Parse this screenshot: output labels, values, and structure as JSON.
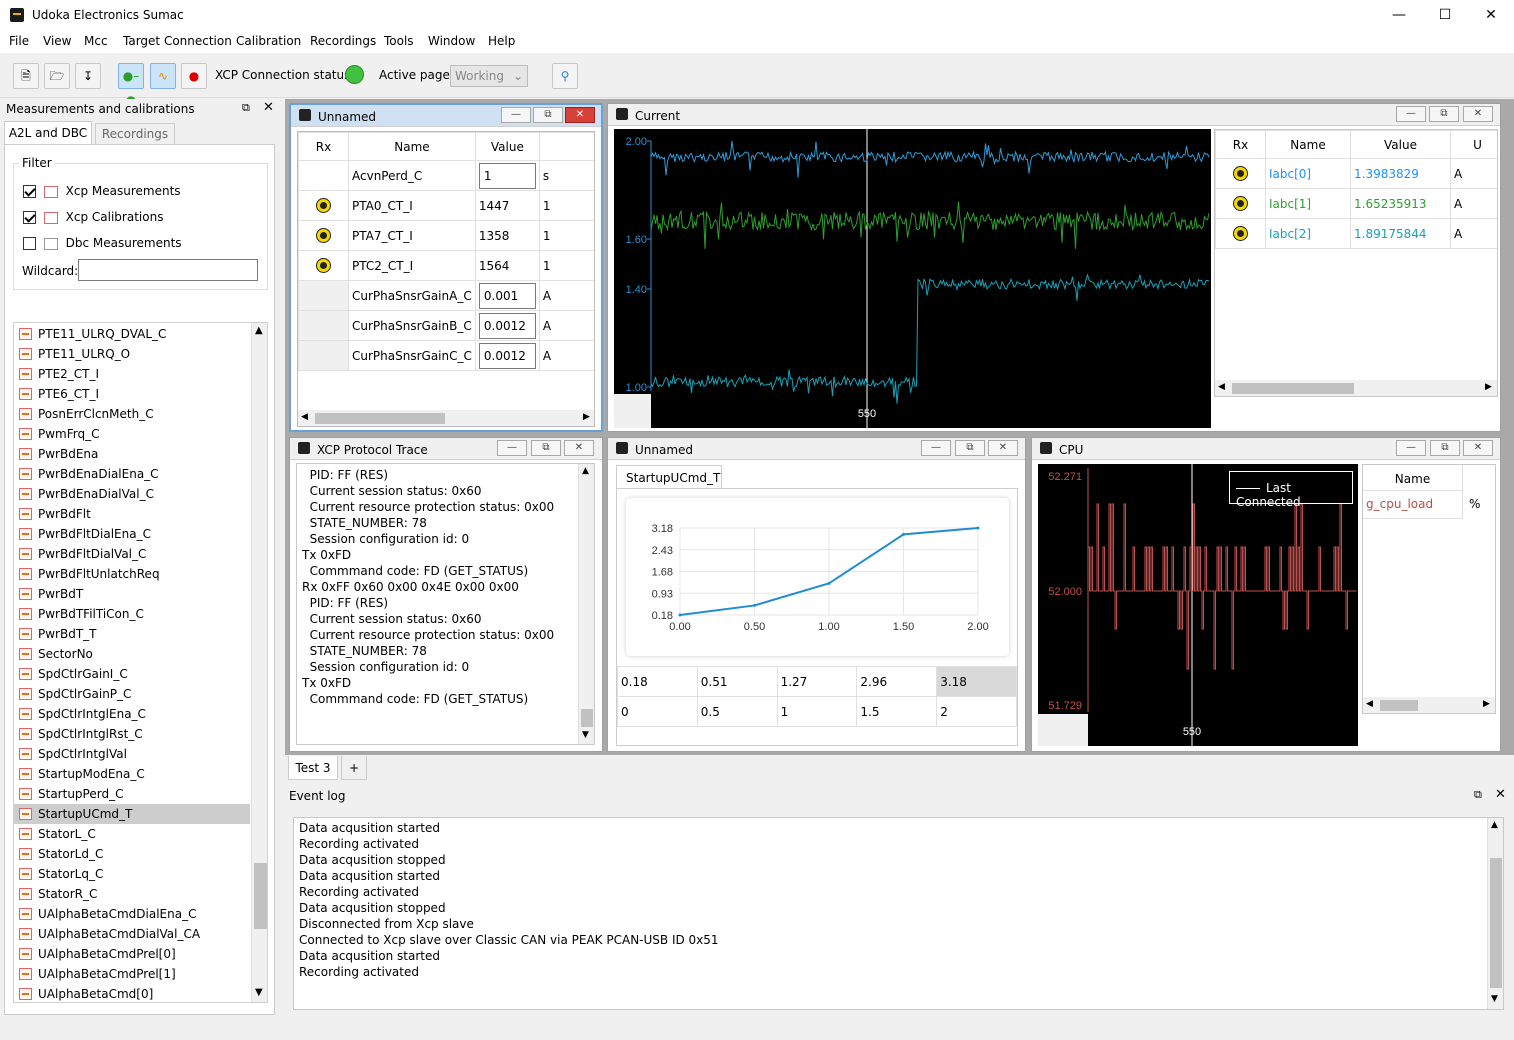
{
  "app": {
    "title": "Udoka Electronics Sumac"
  },
  "menu": [
    "File",
    "View",
    "Mcc",
    "Target Connection",
    "Calibration",
    "Recordings",
    "Tools",
    "Window",
    "Help"
  ],
  "toolbar": {
    "xcp_status_label": "XCP Connection status:",
    "active_page_label": "Active page:",
    "active_page_value": "Working"
  },
  "left_panel": {
    "title": "Measurements and calibrations",
    "tabs": [
      "A2L and DBC",
      "Recordings"
    ],
    "filter_label": "Filter",
    "filters": [
      "Xcp Measurements",
      "Xcp Calibrations",
      "Dbc Measurements"
    ],
    "wildcard_label": "Wildcard:",
    "items": [
      "PTE11_ULRQ_DVAL_C",
      "PTE11_ULRQ_O",
      "PTE2_CT_I",
      "PTE6_CT_I",
      "PosnErrClcnMeth_C",
      "PwmFrq_C",
      "PwrBdEna",
      "PwrBdEnaDialEna_C",
      "PwrBdEnaDialVal_C",
      "PwrBdFlt",
      "PwrBdFltDialEna_C",
      "PwrBdFltDialVal_C",
      "PwrBdFltUnlatchReq",
      "PwrBdT",
      "PwrBdTFilTiCon_C",
      "PwrBdT_T",
      "SectorNo",
      "SpdCtlrGainI_C",
      "SpdCtlrGainP_C",
      "SpdCtlrIntglEna_C",
      "SpdCtlrIntglRst_C",
      "SpdCtlrIntglVal",
      "StartupModEna_C",
      "StartupPerd_C",
      "StartupUCmd_T",
      "StatorL_C",
      "StatorLd_C",
      "StatorLq_C",
      "StatorR_C",
      "UAlphaBetaCmdDialEna_C",
      "UAlphaBetaCmdDialVal_CA",
      "UAlphaBetaCmdPrel[0]",
      "UAlphaBetaCmdPrel[1]",
      "UAlphaBetaCmd[0]"
    ],
    "selected_item": "StartupUCmd_T"
  },
  "unnamed_table": {
    "title": "Unnamed",
    "headers": [
      "Rx",
      "Name",
      "Value"
    ],
    "rows": [
      {
        "name": "AcvnPerd_C",
        "value": "1",
        "unit": "s",
        "rx": false,
        "edit": true
      },
      {
        "name": "PTA0_CT_I",
        "value": "1447",
        "unit": "1",
        "rx": true,
        "edit": false
      },
      {
        "name": "PTA7_CT_I",
        "value": "1358",
        "unit": "1",
        "rx": true,
        "edit": false
      },
      {
        "name": "PTC2_CT_I",
        "value": "1564",
        "unit": "1",
        "rx": true,
        "edit": false
      },
      {
        "name": "CurPhaSnsrGainA_C",
        "value": "0.001",
        "unit": "A",
        "rx": false,
        "edit": true
      },
      {
        "name": "CurPhaSnsrGainB_C",
        "value": "0.0012",
        "unit": "A",
        "rx": false,
        "edit": true
      },
      {
        "name": "CurPhaSnsrGainC_C",
        "value": "0.0012",
        "unit": "A",
        "rx": false,
        "edit": true
      }
    ]
  },
  "current": {
    "title": "Current",
    "y_ticks": [
      "2.00",
      "1.60",
      "1.40",
      "1.00"
    ],
    "x_tick": "550",
    "table_headers": [
      "Rx",
      "Name",
      "Value",
      "U"
    ],
    "rows": [
      {
        "name": "Iabc[0]",
        "value": "1.3983829",
        "unit": "A",
        "color": "#1e90ff"
      },
      {
        "name": "Iabc[1]",
        "value": "1.65235913",
        "unit": "A",
        "color": "#2ca02c"
      },
      {
        "name": "Iabc[2]",
        "value": "1.89175844",
        "unit": "A",
        "color": "#17a2b8"
      }
    ]
  },
  "trace": {
    "title": "XCP Protocol Trace",
    "lines": [
      "  PID: FF (RES)",
      "  Current session status: 0x60",
      "  Current resource protection status: 0x00",
      "  STATE_NUMBER: 78",
      "  Session configuration id: 0",
      "Tx 0xFD",
      "  Commmand code: FD (GET_STATUS)",
      "Rx 0xFF 0x60 0x00 0x4E 0x00 0x00",
      "  PID: FF (RES)",
      "  Current session status: 0x60",
      "  Current resource protection status: 0x00",
      "  STATE_NUMBER: 78",
      "  Session configuration id: 0",
      "Tx 0xFD",
      "  Commmand code: FD (GET_STATUS)"
    ]
  },
  "unnamed_chart": {
    "title": "Unnamed",
    "tab": "StartupUCmd_T",
    "row1": [
      "0.18",
      "0.51",
      "1.27",
      "2.96",
      "3.18"
    ],
    "row2": [
      "0",
      "0.5",
      "1",
      "1.5",
      "2"
    ]
  },
  "chart_data": {
    "type": "line",
    "x": [
      0,
      0.5,
      1,
      1.5,
      2
    ],
    "values": [
      0.18,
      0.51,
      1.27,
      2.96,
      3.18
    ],
    "x_ticks": [
      "0.00",
      "0.50",
      "1.00",
      "1.50",
      "2.00"
    ],
    "y_ticks": [
      "3.18",
      "2.43",
      "1.68",
      "0.93",
      "0.18"
    ],
    "ylim": [
      0.18,
      3.18
    ],
    "xlim": [
      0,
      2
    ],
    "color": "#1f8dd6"
  },
  "cpu": {
    "title": "CPU",
    "y_ticks": [
      "52.271",
      "52.000",
      "51.729"
    ],
    "x_tick": "550",
    "legend": "Last Connected",
    "table_header": "Name",
    "row": {
      "name": "g_cpu_load",
      "unit": "%"
    }
  },
  "tabs_bottom": {
    "tab": "Test 3",
    "add": "+"
  },
  "event_log": {
    "title": "Event log",
    "lines": [
      "Data acqusition started",
      "Recording activated",
      "Data acqusition stopped",
      "Data acqusition started",
      "Recording activated",
      "Data acqusition stopped",
      "Disconnected from Xcp slave",
      "Connected to Xcp slave over Classic CAN via PEAK PCAN-USB ID 0x51",
      "Data acqusition started",
      "Recording activated"
    ]
  }
}
